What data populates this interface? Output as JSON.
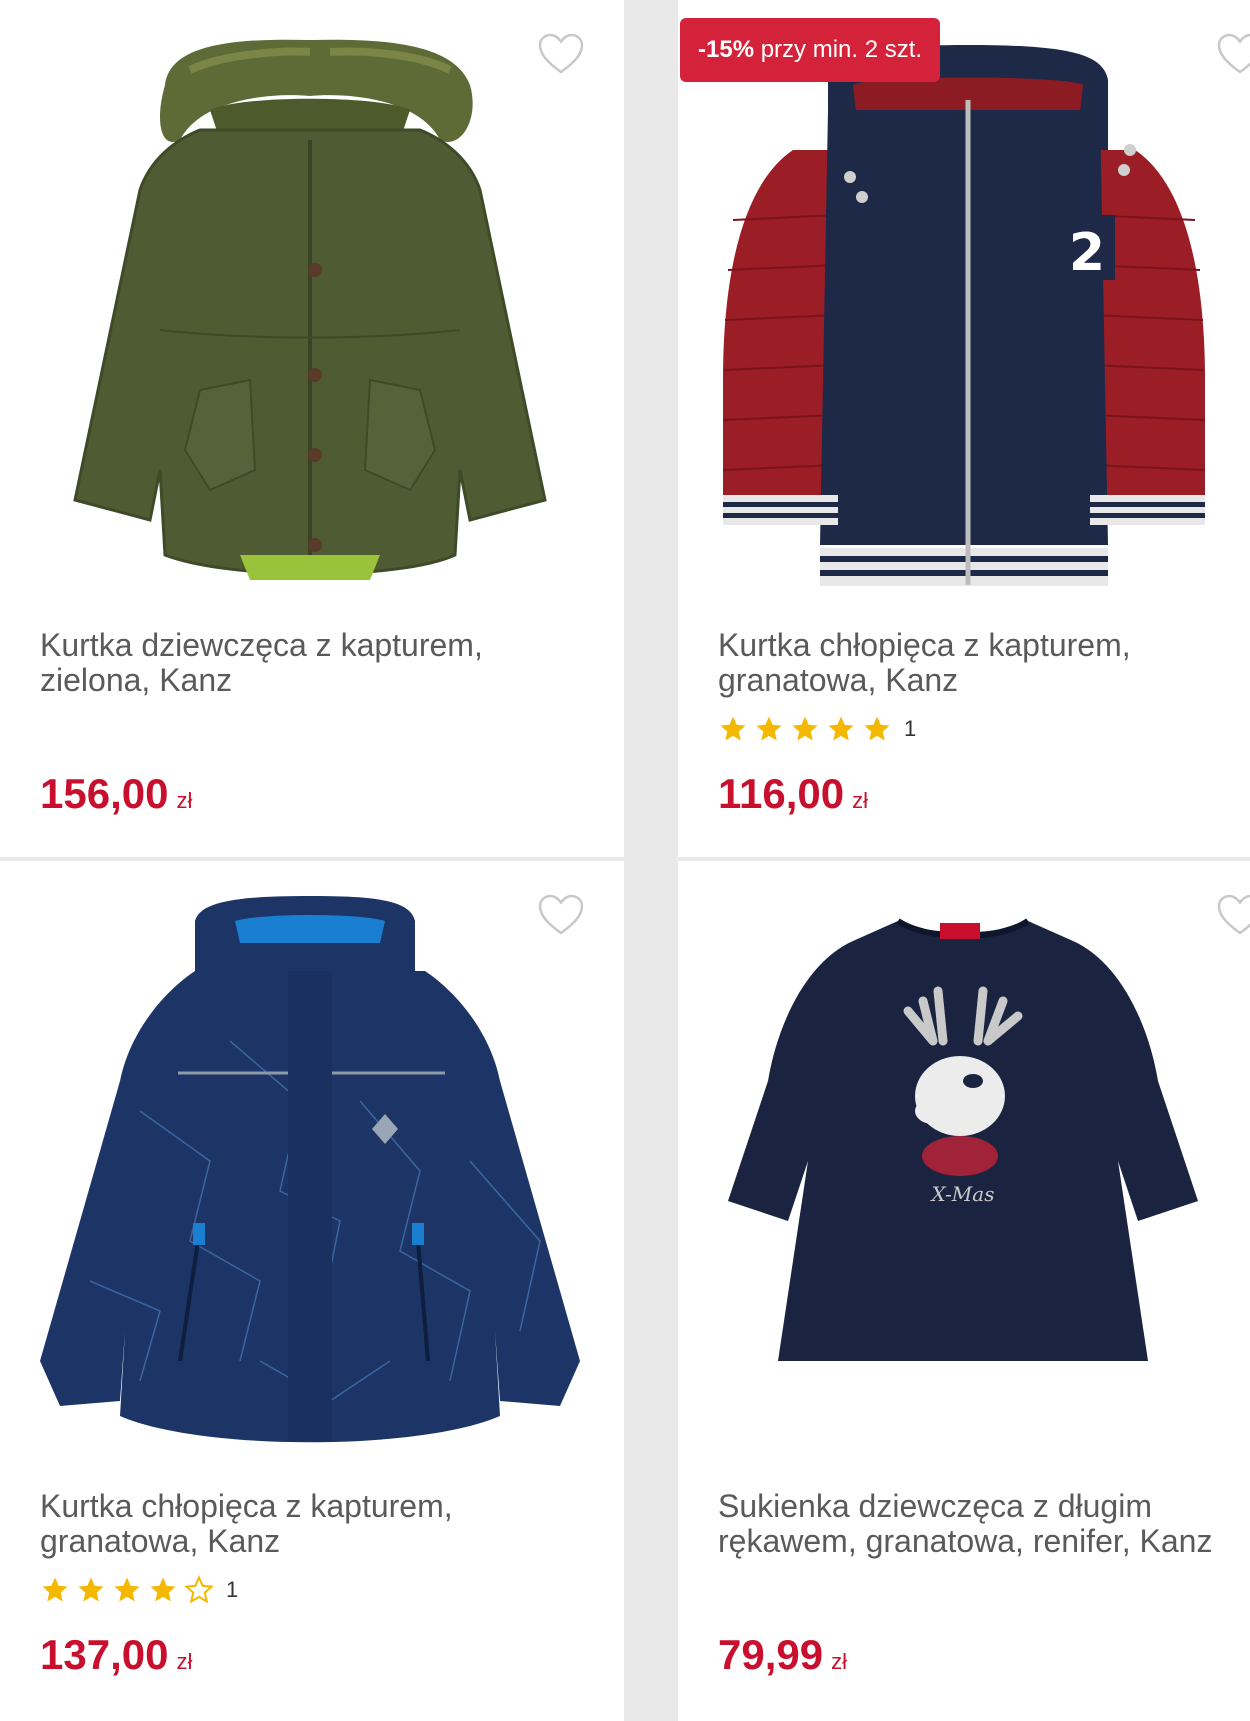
{
  "colors": {
    "accent": "#c8102e",
    "badge": "#d3223a",
    "star": "#f5b800",
    "text": "#5a5a5a"
  },
  "products": [
    {
      "title": "Kurtka dziewczęca z kapturem, zielona, Kanz",
      "price": "156,00",
      "currency": "zł",
      "rating": null,
      "badge": null,
      "image": "green-parka"
    },
    {
      "title": "Kurtka chłopięca z kapturem, granatowa, Kanz",
      "price": "116,00",
      "currency": "zł",
      "rating": {
        "stars": 5,
        "count": "1"
      },
      "badge": {
        "percent": "-15%",
        "text": "przy min. 2 szt."
      },
      "image": "navy-red-jacket"
    },
    {
      "title": "Kurtka chłopięca z kapturem, granatowa, Kanz",
      "price": "137,00",
      "currency": "zł",
      "rating": {
        "stars": 4,
        "count": "1"
      },
      "badge": null,
      "image": "navy-patterned-jacket"
    },
    {
      "title": "Sukienka dziewczęca z długim rękawem, granatowa, renifer, Kanz",
      "price": "79,99",
      "currency": "zł",
      "rating": null,
      "badge": null,
      "image": "navy-reindeer-dress"
    }
  ],
  "icons": {
    "favorite": "heart-outline-icon",
    "star": "star-icon"
  }
}
